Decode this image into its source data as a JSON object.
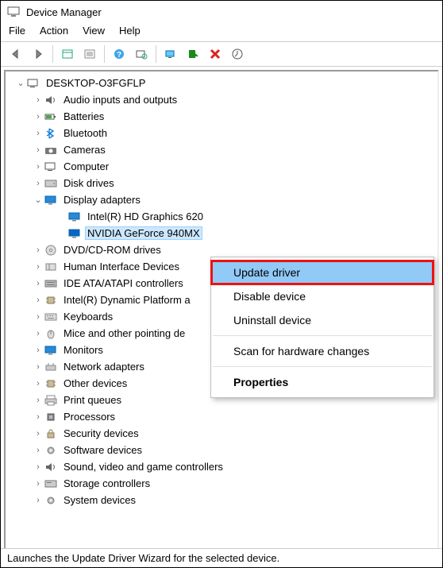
{
  "window": {
    "title": "Device Manager"
  },
  "menu": {
    "file": "File",
    "action": "Action",
    "view": "View",
    "help": "Help"
  },
  "tree": {
    "root": "DESKTOP-O3FGFLP",
    "categories": [
      {
        "id": "audio",
        "label": "Audio inputs and outputs",
        "expanded": false
      },
      {
        "id": "batteries",
        "label": "Batteries",
        "expanded": false
      },
      {
        "id": "bluetooth",
        "label": "Bluetooth",
        "expanded": false
      },
      {
        "id": "cameras",
        "label": "Cameras",
        "expanded": false
      },
      {
        "id": "computer",
        "label": "Computer",
        "expanded": false
      },
      {
        "id": "disk",
        "label": "Disk drives",
        "expanded": false
      },
      {
        "id": "display",
        "label": "Display adapters",
        "expanded": true,
        "children": [
          {
            "id": "intel",
            "label": "Intel(R) HD Graphics 620"
          },
          {
            "id": "nvidia",
            "label": "NVIDIA GeForce 940MX",
            "selected": true
          }
        ]
      },
      {
        "id": "dvd",
        "label": "DVD/CD-ROM drives",
        "expanded": false
      },
      {
        "id": "hid",
        "label": "Human Interface Devices",
        "expanded": false
      },
      {
        "id": "ide",
        "label": "IDE ATA/ATAPI controllers",
        "expanded": false
      },
      {
        "id": "dptf",
        "label": "Intel(R) Dynamic Platform a",
        "expanded": false
      },
      {
        "id": "keyboards",
        "label": "Keyboards",
        "expanded": false
      },
      {
        "id": "mice",
        "label": "Mice and other pointing de",
        "expanded": false
      },
      {
        "id": "monitors",
        "label": "Monitors",
        "expanded": false
      },
      {
        "id": "network",
        "label": "Network adapters",
        "expanded": false
      },
      {
        "id": "other",
        "label": "Other devices",
        "expanded": false
      },
      {
        "id": "printq",
        "label": "Print queues",
        "expanded": false
      },
      {
        "id": "processors",
        "label": "Processors",
        "expanded": false
      },
      {
        "id": "security",
        "label": "Security devices",
        "expanded": false
      },
      {
        "id": "software",
        "label": "Software devices",
        "expanded": false
      },
      {
        "id": "sound",
        "label": "Sound, video and game controllers",
        "expanded": false
      },
      {
        "id": "storage",
        "label": "Storage controllers",
        "expanded": false
      },
      {
        "id": "system",
        "label": "System devices",
        "expanded": false
      }
    ]
  },
  "context_menu": {
    "update": "Update driver",
    "disable": "Disable device",
    "uninstall": "Uninstall device",
    "scan": "Scan for hardware changes",
    "properties": "Properties"
  },
  "statusbar": "Launches the Update Driver Wizard for the selected device.",
  "icons": {
    "audio": "speaker",
    "batteries": "battery",
    "bluetooth": "bluetooth",
    "cameras": "camera",
    "computer": "computer",
    "disk": "disk",
    "display": "monitor",
    "dvd": "disc",
    "hid": "hid",
    "ide": "ide",
    "dptf": "chip",
    "keyboards": "keyboard",
    "mice": "mouse",
    "monitors": "monitor",
    "network": "net",
    "other": "chip",
    "printq": "printer",
    "processors": "cpu",
    "security": "lock",
    "software": "gear",
    "sound": "speaker",
    "storage": "storage",
    "system": "gear"
  }
}
